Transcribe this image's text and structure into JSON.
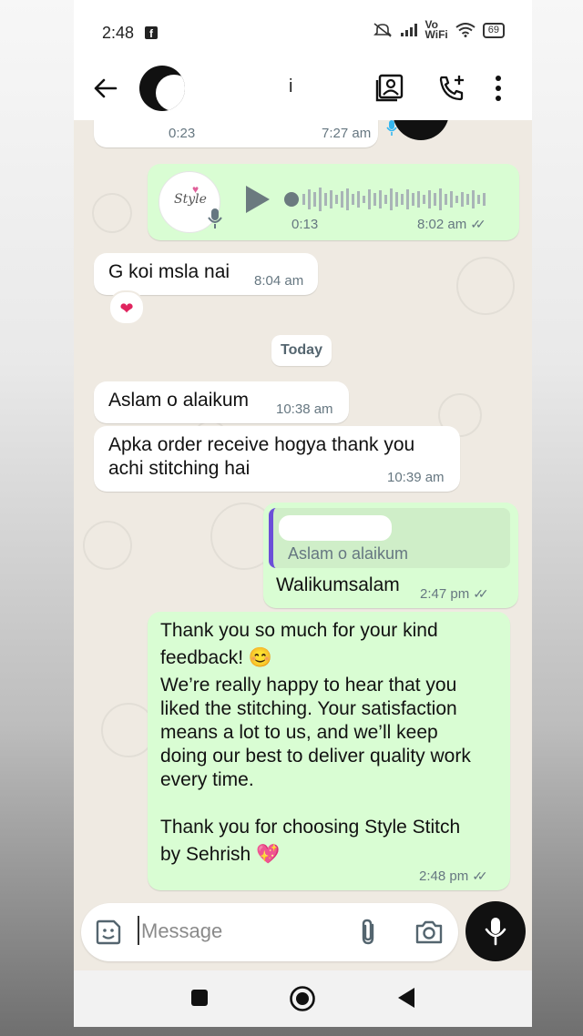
{
  "status_bar": {
    "time": "2:48",
    "fb_glyph": "f",
    "net_label": "Vo\nWiFi",
    "battery": "69"
  },
  "header": {
    "contact_name": "i"
  },
  "messages": {
    "prev_voice": {
      "duration": "0:23",
      "time": "7:27 am"
    },
    "voice": {
      "duration": "0:13",
      "time": "8:02 am"
    },
    "m1": {
      "text": "G koi msla nai",
      "time": "8:04 am",
      "reaction": "❤"
    },
    "date_chip": "Today",
    "m2": {
      "text": "Aslam o alaikum",
      "time": "10:38 am"
    },
    "m3": {
      "text_line1": "Apka order receive hogya thank you",
      "text_line2": "achi stitching hai",
      "time": "10:39 am"
    },
    "m4": {
      "quoted": "Aslam o alaikum",
      "text": "Walikumsalam",
      "time": "2:47 pm"
    },
    "m5": {
      "l1": "Thank you so much for your kind",
      "l2": "feedback! 😊",
      "l3": "We’re really happy to hear that you",
      "l4": "liked the stitching. Your satisfaction",
      "l5": "means a lot to us, and we’ll keep",
      "l6": "doing our best to deliver quality work",
      "l7": "every time.",
      "l8": "Thank you for choosing Style Stitch",
      "l9": "by Sehrish 💖",
      "time": "2:48 pm"
    }
  },
  "input": {
    "placeholder": "Message"
  },
  "colors": {
    "outgoing": "#d9fdd3",
    "incoming": "#ffffff",
    "wallpaper": "#efeae2",
    "tick": "#667781"
  },
  "icons": [
    "back-arrow-icon",
    "gallery-icon",
    "add-call-icon",
    "more-vert-icon",
    "play-icon",
    "mic-icon",
    "sticker-icon",
    "attach-icon",
    "camera-icon",
    "nav-square-icon",
    "nav-home-icon",
    "nav-back-icon"
  ]
}
